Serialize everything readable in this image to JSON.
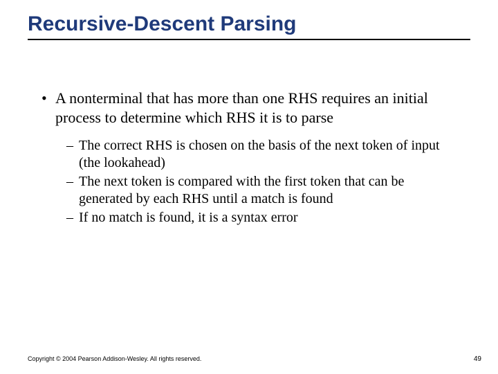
{
  "slide": {
    "title": "Recursive-Descent Parsing",
    "bullets": [
      {
        "text": "A nonterminal that has more than one RHS requires an initial process to determine which RHS it is to parse",
        "subs": [
          "The correct RHS is chosen on the basis of the next token of input (the lookahead)",
          "The next token is compared with the first token that can be generated by each RHS until a match is found",
          "If no match is found, it is a syntax error"
        ]
      }
    ]
  },
  "footer": {
    "copyright": "Copyright © 2004 Pearson Addison-Wesley. All rights reserved.",
    "page": "49"
  },
  "marks": {
    "bullet": "•",
    "dash": "–"
  }
}
